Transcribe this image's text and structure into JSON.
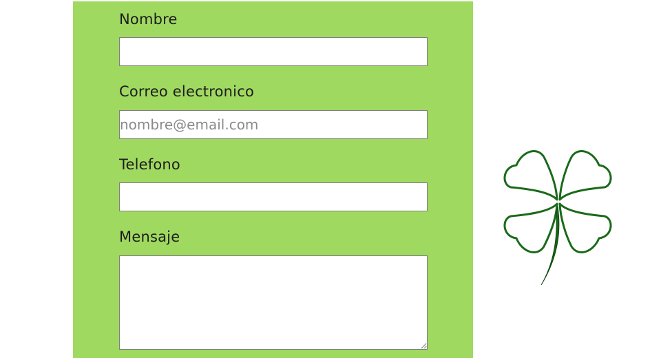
{
  "form": {
    "name_label": "Nombre",
    "name_value": "",
    "email_label": "Correo electronico",
    "email_placeholder": "nombre@email.com",
    "email_value": "",
    "phone_label": "Telefono",
    "phone_value": "",
    "message_label": "Mensaje",
    "message_value": ""
  },
  "colors": {
    "panel_background": "#a0d960",
    "clover_stroke": "#1a6a1a"
  },
  "decor": {
    "clover_icon": "four-leaf-clover-icon"
  }
}
